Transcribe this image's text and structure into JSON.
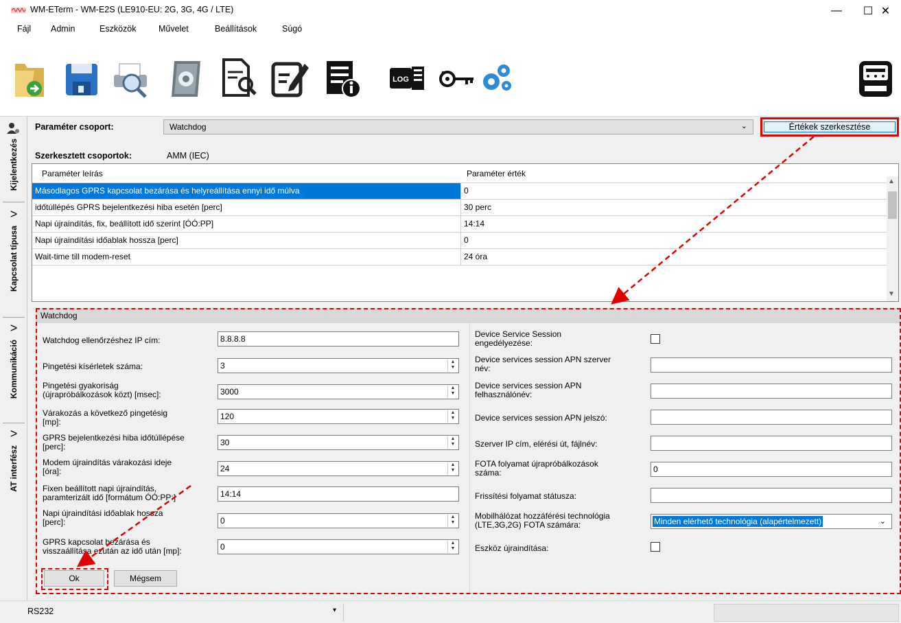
{
  "window": {
    "title": "WM-ETerm - WM-E2S (LE910-EU: 2G, 3G, 4G / LTE)",
    "minimize": "—",
    "maximize": "☐",
    "close": "✕"
  },
  "menu": [
    "Fájl",
    "Admin",
    "Eszközök",
    "Művelet",
    "Beállítások",
    "Súgó"
  ],
  "toolbar": {
    "icons": [
      "open-folder-icon",
      "save-disk-icon",
      "print-preview-icon",
      "gear-book-icon",
      "document-search-icon",
      "edit-document-icon",
      "document-info-icon",
      "log-icon",
      "key-refresh-icon",
      "gears-icon",
      "meter-icon"
    ],
    "log_text": "LOG"
  },
  "left_tabs": {
    "login": "Kijelentkezés",
    "connection_type": "Kapcsolat típusa",
    "communication": "Kommunikáció",
    "at_interface": "AT interfész"
  },
  "header": {
    "param_group_label": "Paraméter csoport:",
    "param_group_value": "Watchdog",
    "edit_values_button": "Értékek szerkesztése",
    "edited_groups_label": "Szerkesztett csoportok:",
    "edited_groups_value": "AMM (IEC)"
  },
  "table": {
    "columns": [
      "Paraméter leírás",
      "Paraméter érték"
    ],
    "rows": [
      {
        "desc": "Másodlagos GPRS kapcsolat bezárása és helyreállítása ennyi idő múlva",
        "value": "0",
        "selected": true
      },
      {
        "desc": "időtúllépés GPRS bejelentkezési hiba esetén [perc]",
        "value": "30 perc"
      },
      {
        "desc": "Napi újraindítás, fix, beállított idő szerint [ÓÓ:PP]",
        "value": "14:14"
      },
      {
        "desc": "Napi újraindítási időablak hossza [perc]",
        "value": "0"
      },
      {
        "desc": "Wait-time till modem-reset",
        "value": "24 óra"
      }
    ]
  },
  "group_box": {
    "title": "Watchdog",
    "left_fields": [
      {
        "label": "Watchdog ellenőrzéshez IP cím:",
        "value": "8.8.8.8"
      },
      {
        "label": "Pingetési kísérletek száma:",
        "value": "3"
      },
      {
        "label": "Pingetési gyakoriság\n(újrapróbálkozások közt) [msec]:",
        "value": "3000"
      },
      {
        "label": "Várakozás a következő pingetésig\n[mp]:",
        "value": "120"
      },
      {
        "label": "GPRS bejelentkezési hiba időtúllépése\n[perc]:",
        "value": "30"
      },
      {
        "label": "Modem újraindítás várakozási ideje\n[óra]:",
        "value": "24"
      },
      {
        "label": "Fixen beállított napi újraindítás,\nparamterizált idő [formátum ÓÓ:PP:]",
        "value": "14:14"
      },
      {
        "label": "Napi újraindítási időablak hossza\n[perc]:",
        "value": "0"
      },
      {
        "label": "GPRS kapcsolat bezárása és\nvisszaállítása ezután az idő után [mp]:",
        "value": "0"
      }
    ],
    "right_fields": [
      {
        "label": "Device Service Session\nengedélyezése:"
      },
      {
        "label": "Device services session APN szerver\nnév:",
        "value": ""
      },
      {
        "label": "Device services session APN\nfelhasználónév:",
        "value": ""
      },
      {
        "label": "Device services session APN jelszó:",
        "value": ""
      },
      {
        "label": "Szerver IP cím, elérési út, fájlnév:",
        "value": ""
      },
      {
        "label": "FOTA folyamat újrapróbálkozások\nszáma:",
        "value": "0"
      },
      {
        "label": "Frissítési folyamat státusza:",
        "value": ""
      },
      {
        "label": "Mobilhálózat hozzáférési technológia\n(LTE,3G,2G) FOTA számára:",
        "value": "Minden elérhető technológia (alapértelmezett)"
      },
      {
        "label": "Eszköz újraindítása:"
      }
    ],
    "ok_button": "Ok",
    "cancel_button": "Mégsem"
  },
  "statusbar": {
    "port": "RS232",
    "dropdown_arrow": "▾"
  },
  "colors": {
    "selection": "#0078d7",
    "annotation": "#e00000"
  }
}
